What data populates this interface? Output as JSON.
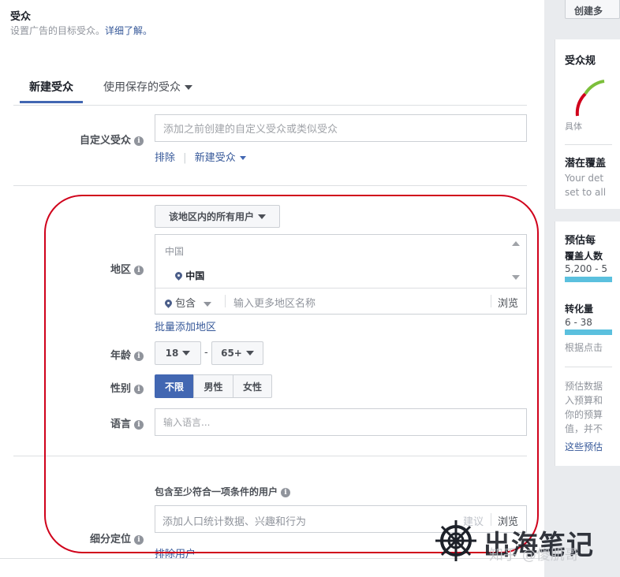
{
  "header": {
    "title": "受众",
    "subtitle": "设置广告的目标受众。",
    "learn_more": "详细了解。"
  },
  "tabs": [
    {
      "label": "新建受众",
      "active": true
    },
    {
      "label": "使用保存的受众",
      "active": false
    }
  ],
  "custom_audience": {
    "label": "自定义受众",
    "placeholder": "添加之前创建的自定义受众或类似受众",
    "exclude_link": "排除",
    "create_link": "新建受众"
  },
  "location": {
    "label": "地区",
    "dropdown": "该地区内的所有用户",
    "group_label": "中国",
    "selected": "中国",
    "include": "包含",
    "placeholder": "输入更多地区名称",
    "browse": "浏览",
    "bulk_add": "批量添加地区"
  },
  "age": {
    "label": "年龄",
    "min": "18",
    "dash": "-",
    "max": "65+"
  },
  "gender": {
    "label": "性别",
    "options": [
      "不限",
      "男性",
      "女性"
    ],
    "selected": "不限"
  },
  "language": {
    "label": "语言",
    "placeholder": "输入语言..."
  },
  "detailed_targeting": {
    "label": "细分定位",
    "condition": "包含至少符合一项条件的用户",
    "placeholder": "添加人口统计数据、兴趣和行为",
    "suggest": "建议",
    "browse": "浏览",
    "exclude": "排除用户"
  },
  "sidebar": {
    "top_button": "创建多",
    "audience_size_title": "受众规",
    "gauge_label": "具体",
    "potential_reach_title": "潜在覆盖",
    "potential_reach_text1": "Your det",
    "potential_reach_text2": "set to all",
    "estimate_title": "预估每",
    "reach_label": "覆盖人数",
    "reach_value": "5,200 - 5",
    "conversions_label": "转化量",
    "conversions_value": "6 - 38",
    "based_on": "根据点击",
    "note_lines": [
      "预估数据",
      "入预算和",
      "你的预算",
      "值，并不"
    ],
    "note_link": "这些预估"
  },
  "watermark": {
    "brand": "出海笔记",
    "credit": "知乎 @傻肌哥"
  },
  "colors": {
    "accent": "#4267b2",
    "annotation": "#d0021b",
    "bar": "#5bc0de"
  }
}
